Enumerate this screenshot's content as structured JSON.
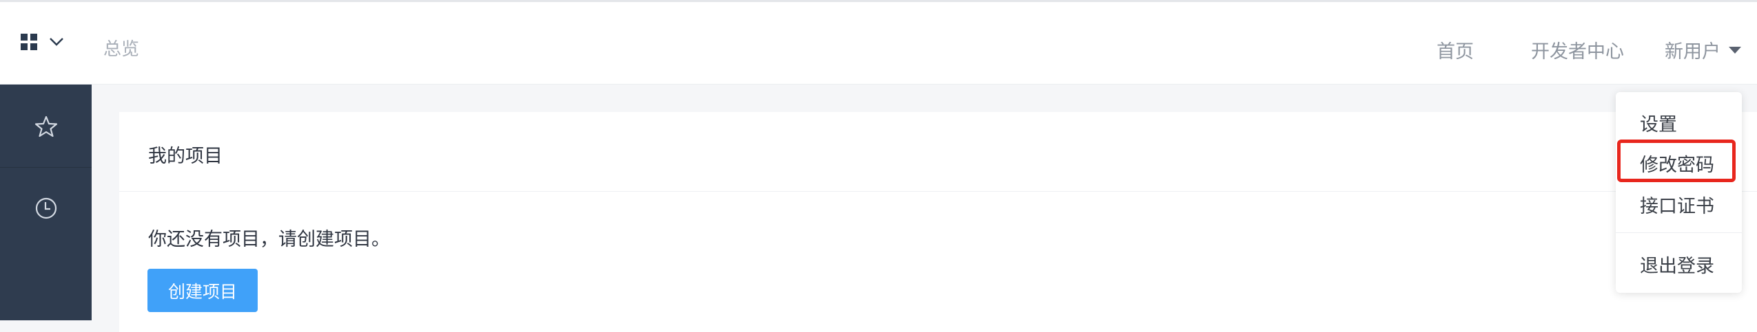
{
  "header": {
    "breadcrumb": "总览",
    "nav": {
      "home": "首页",
      "developer_center": "开发者中心",
      "user": "新用户"
    },
    "icons": {
      "app_switcher": "grid-icon",
      "switcher_chevron": "chevron-down-icon",
      "user_caret": "caret-down-icon"
    }
  },
  "sidebar": {
    "items": [
      {
        "icon": "star-icon"
      },
      {
        "icon": "clock-icon"
      }
    ]
  },
  "main": {
    "card_title": "我的项目",
    "empty_message": "你还没有项目，请创建项目。",
    "create_button": "创建项目"
  },
  "user_menu": {
    "items": [
      "设置",
      "修改密码",
      "接口证书",
      "退出登录"
    ],
    "highlighted_item": "修改密码"
  },
  "colors": {
    "sidebar_bg": "#2f3c4f",
    "primary_button": "#40a1f9",
    "highlight_border": "#e8261d"
  }
}
